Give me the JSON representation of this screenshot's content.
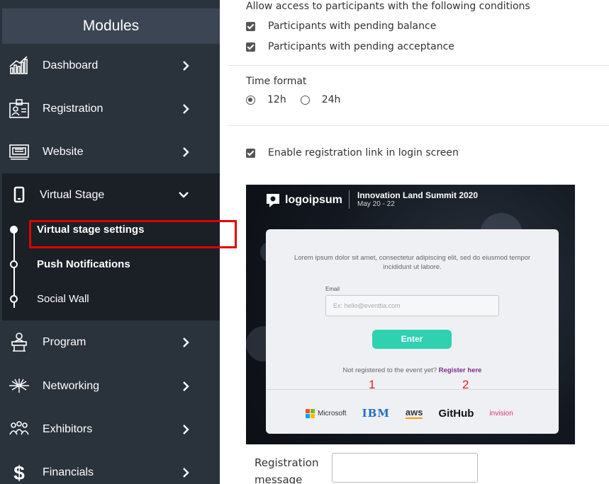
{
  "sidebar": {
    "title": "Modules",
    "items": [
      {
        "label": "Dashboard",
        "icon": "dashboard-icon"
      },
      {
        "label": "Registration",
        "icon": "badge-icon"
      },
      {
        "label": "Website",
        "icon": "monitor-icon"
      },
      {
        "label": "Virtual Stage",
        "icon": "phone-icon"
      },
      {
        "label": "Program",
        "icon": "podium-icon"
      },
      {
        "label": "Networking",
        "icon": "network-icon"
      },
      {
        "label": "Exhibitors",
        "icon": "people-icon"
      },
      {
        "label": "Financials",
        "icon": "dollar-icon"
      }
    ],
    "virtual_stage_subitems": [
      {
        "label": "Virtual stage settings"
      },
      {
        "label": "Push Notifications"
      },
      {
        "label": "Social Wall"
      }
    ],
    "highlight_color": "#e00000"
  },
  "main": {
    "access_heading": "Allow access to participants with the following conditions",
    "checkbox_pending_balance": "Participants with pending balance",
    "checkbox_pending_acceptance": "Participants with pending acceptance",
    "time_format_label": "Time format",
    "time_options": [
      "12h",
      "24h"
    ],
    "time_selected": "12h",
    "enable_registration_link": "Enable registration link in login screen",
    "registration_message_label": "Registration message",
    "registration_message_value": ""
  },
  "preview": {
    "logo_text": "logoipsum",
    "event_title": "Innovation Land Summit 2020",
    "event_date": "May 20 - 22",
    "lorem": "Lorem ipsum dolor sit amet, consectetur adipiscing elit, sed do eiusmod tempor incididunt ut labore.",
    "email_label": "Email",
    "email_placeholder": "Ex: hello@eventtia.com",
    "enter_button": "Enter",
    "not_registered": "Not registered to the event yet?",
    "register_link": "Register here",
    "annotation_1": "1",
    "annotation_2": "2",
    "sponsors": [
      "Microsoft",
      "IBM",
      "aws",
      "GitHub",
      "invision"
    ],
    "accent_color": "#2fd1b1",
    "link_color": "#7c2c8c"
  }
}
